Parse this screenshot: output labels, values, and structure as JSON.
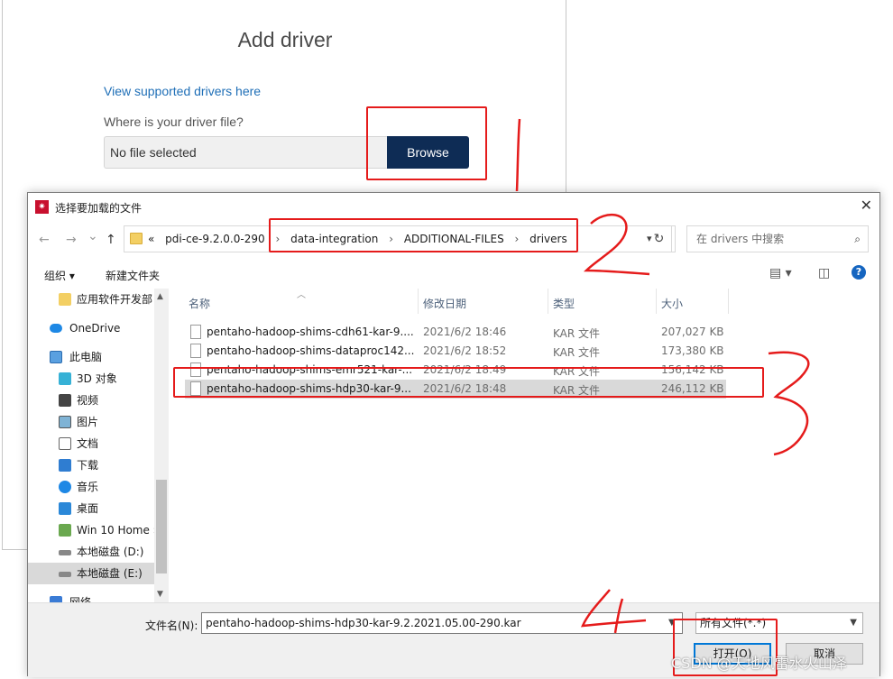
{
  "web_panel": {
    "title": "Add driver",
    "link": "View supported drivers here",
    "question": "Where is your driver file?",
    "file_placeholder": "No file selected",
    "browse_label": "Browse"
  },
  "dialog": {
    "title": "选择要加载的文件",
    "close": "✕",
    "app_icon": "pdi-app-icon",
    "nav": {
      "back": "←",
      "forward": "→",
      "recent": "⌄",
      "up": "↑"
    },
    "address": {
      "prefix": "«",
      "crumbs": [
        "pdi-ce-9.2.0.0-290",
        "data-integration",
        "ADDITIONAL-FILES",
        "drivers"
      ],
      "separator": "›"
    },
    "refresh": "↻",
    "search_placeholder": "在 drivers 中搜索",
    "toolbar": {
      "organize": "组织 ▾",
      "new_folder": "新建文件夹",
      "view_icon": "▤ ▾",
      "pane_icon": "◫",
      "help": "?"
    },
    "nav_pane": [
      {
        "label": "应用软件开发部"
      },
      {
        "label": "OneDrive"
      },
      {
        "label": "此电脑"
      },
      {
        "label": "3D 对象"
      },
      {
        "label": "视频"
      },
      {
        "label": "图片"
      },
      {
        "label": "文档"
      },
      {
        "label": "下载"
      },
      {
        "label": "音乐"
      },
      {
        "label": "桌面"
      },
      {
        "label": "Win 10 Home ›"
      },
      {
        "label": "本地磁盘 (D:)"
      },
      {
        "label": "本地磁盘 (E:)"
      },
      {
        "label": "网络"
      }
    ],
    "columns": {
      "name": "名称",
      "modified": "修改日期",
      "type": "类型",
      "size": "大小"
    },
    "files": [
      {
        "name": "pentaho-hadoop-shims-cdh61-kar-9....",
        "modified": "2021/6/2 18:46",
        "type": "KAR 文件",
        "size": "207,027 KB"
      },
      {
        "name": "pentaho-hadoop-shims-dataproc142...",
        "modified": "2021/6/2 18:52",
        "type": "KAR 文件",
        "size": "173,380 KB"
      },
      {
        "name": "pentaho-hadoop-shims-emr521-kar-...",
        "modified": "2021/6/2 18:49",
        "type": "KAR 文件",
        "size": "156,142 KB"
      },
      {
        "name": "pentaho-hadoop-shims-hdp30-kar-9...",
        "modified": "2021/6/2 18:48",
        "type": "KAR 文件",
        "size": "246,112 KB"
      }
    ],
    "filename_label": "文件名(N):",
    "filename_value": "pentaho-hadoop-shims-hdp30-kar-9.2.2021.05.00-290.kar",
    "filetype": "所有文件(*.*)",
    "open_label": "打开(O)",
    "cancel_label": "取消"
  },
  "annotations": {
    "step1": "1",
    "step2": "2",
    "step3": "3",
    "step4": "4",
    "color": "#e51b1b"
  },
  "watermark": "CSDN @天地风雷水火山泽"
}
